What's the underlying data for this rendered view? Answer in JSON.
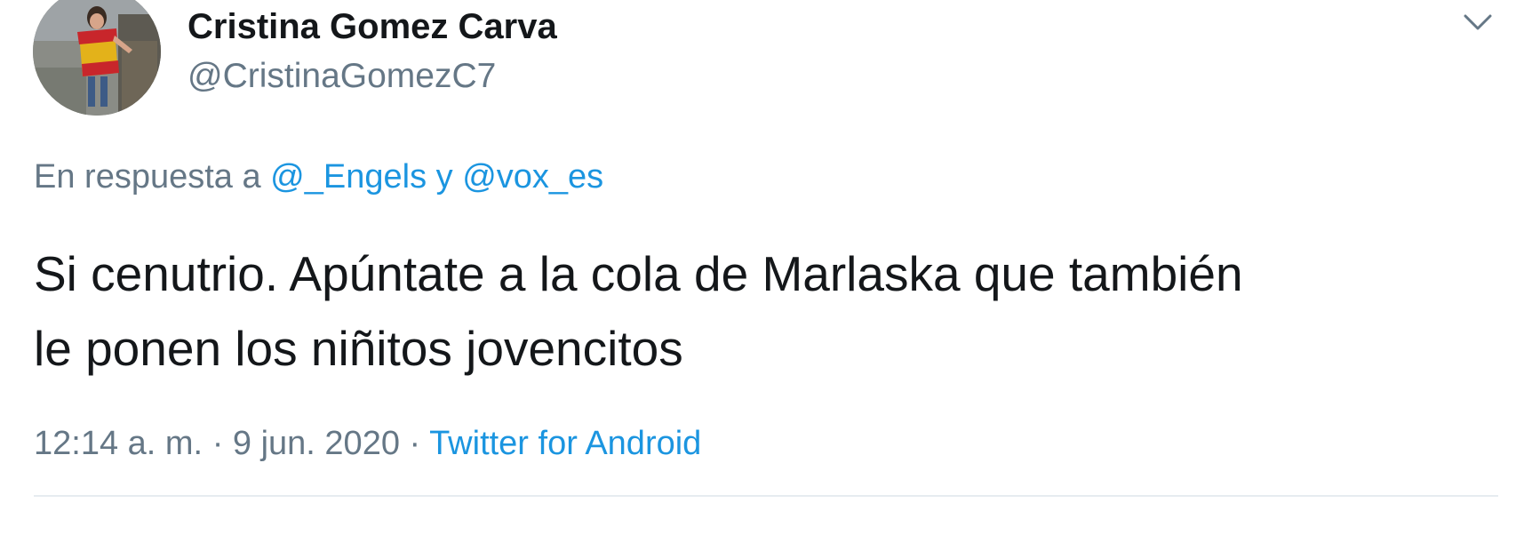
{
  "author": {
    "display_name": "Cristina Gomez Carva",
    "handle": "@CristinaGomezC7"
  },
  "icons": {
    "avatar": "profile-photo",
    "caret": "chevron-down-icon"
  },
  "reply": {
    "prefix": "En respuesta a",
    "mentions": [
      "@_Engels",
      "@vox_es"
    ],
    "joiner": "y"
  },
  "tweet": {
    "lines": [
      "Si cenutrio. Apúntate a la cola de Marlaska que también",
      "le ponen los niñitos jovencitos"
    ]
  },
  "meta": {
    "time": "12:14 a. m.",
    "date": "9 jun. 2020",
    "separator": "·",
    "source": "Twitter for Android"
  },
  "colors": {
    "text": "#14171a",
    "secondary": "#657786",
    "link": "#1b95e0",
    "divider": "#e6ecf0"
  }
}
